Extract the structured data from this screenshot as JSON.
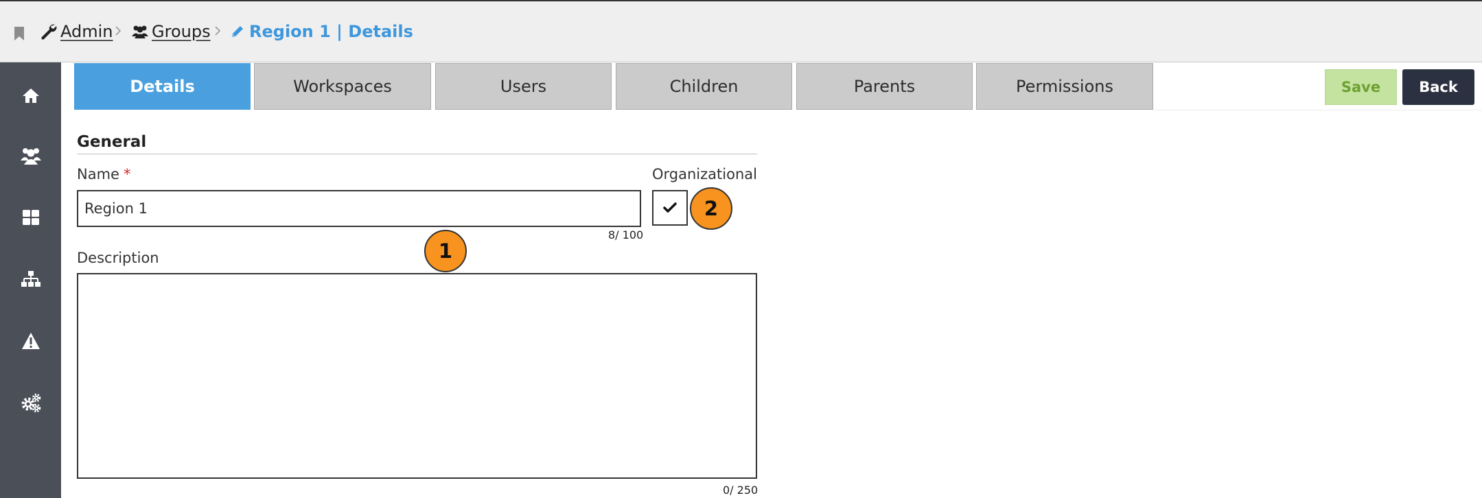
{
  "breadcrumb": {
    "items": [
      {
        "label": "Admin",
        "icon": "wrench-icon"
      },
      {
        "label": "Groups",
        "icon": "users-icon"
      }
    ],
    "current": "Region 1 | Details"
  },
  "sidebar": {
    "items": [
      {
        "icon": "home-icon"
      },
      {
        "icon": "users-icon"
      },
      {
        "icon": "grid-icon"
      },
      {
        "icon": "sitemap-icon"
      },
      {
        "icon": "warning-icon"
      },
      {
        "icon": "cogs-icon"
      }
    ]
  },
  "tabs": [
    {
      "label": "Details",
      "active": true
    },
    {
      "label": "Workspaces"
    },
    {
      "label": "Users"
    },
    {
      "label": "Children"
    },
    {
      "label": "Parents"
    },
    {
      "label": "Permissions"
    }
  ],
  "toolbar": {
    "save_label": "Save",
    "back_label": "Back"
  },
  "form": {
    "section_title": "General",
    "name": {
      "label": "Name",
      "required_mark": "*",
      "value": "Region 1",
      "counter": "8/ 100"
    },
    "organizational": {
      "label": "Organizational",
      "checked": true
    },
    "description": {
      "label": "Description",
      "value": "",
      "counter": "0/ 250"
    }
  },
  "annotations": {
    "marker1": "1",
    "marker2": "2"
  },
  "colors": {
    "accent": "#4aa0df",
    "sidebar": "#4a4f58",
    "save_bg": "#c4e3a0",
    "back_bg": "#2b3140",
    "marker": "#f7931e"
  }
}
